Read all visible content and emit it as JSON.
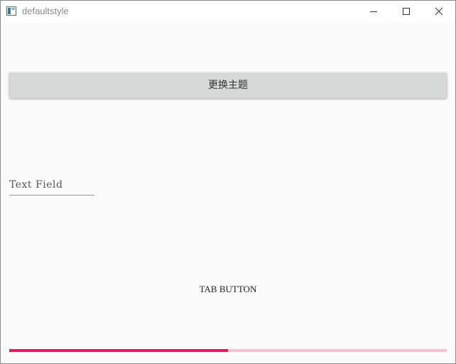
{
  "window": {
    "title": "defaultstyle",
    "app_icon": "app-window-icon",
    "controls": {
      "minimize_icon": "minimize-icon",
      "maximize_icon": "maximize-icon",
      "close_icon": "close-icon"
    }
  },
  "main": {
    "theme_button_label": "更换主题",
    "text_field": {
      "placeholder": "Text Field",
      "value": ""
    },
    "tab_button_label": "TAB BUTTON",
    "progress": {
      "value": 0.5,
      "fill_color": "#d81b60",
      "track_color": "#f2c3d3"
    }
  }
}
